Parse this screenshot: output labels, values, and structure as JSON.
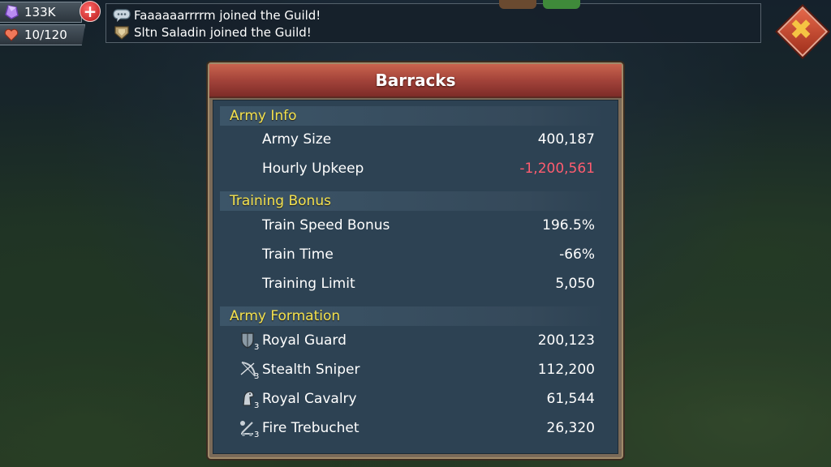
{
  "top_bar": {
    "gems": "133K",
    "stamina": "10/120",
    "plus": "+"
  },
  "feed": [
    {
      "text": "Faaaaaarrrrm joined the Guild!",
      "icon": "chat-bubble-icon"
    },
    {
      "text": "Sltn Saladin joined the Guild!",
      "icon": "guild-crest-icon"
    }
  ],
  "close": {
    "symbol": "✖"
  },
  "panel": {
    "title": "Barracks",
    "sections": [
      {
        "title": "Army Info",
        "rows": [
          {
            "label": "Army Size",
            "value": "400,187"
          },
          {
            "label": "Hourly Upkeep",
            "value": "-1,200,561"
          }
        ]
      },
      {
        "title": "Training Bonus",
        "rows": [
          {
            "label": "Train Speed Bonus",
            "value": "196.5%"
          },
          {
            "label": "Train Time",
            "value": "-66%"
          },
          {
            "label": "Training Limit",
            "value": "5,050"
          }
        ]
      },
      {
        "title": "Army Formation",
        "rows": [
          {
            "label": "Royal Guard",
            "value": "200,123",
            "icon": "shield-icon",
            "tier": "3"
          },
          {
            "label": "Stealth Sniper",
            "value": "112,200",
            "icon": "bow-icon",
            "tier": "3"
          },
          {
            "label": "Royal Cavalry",
            "value": "61,544",
            "icon": "horse-icon",
            "tier": "3"
          },
          {
            "label": "Fire Trebuchet",
            "value": "26,320",
            "icon": "trebuchet-icon",
            "tier": "3"
          }
        ]
      }
    ]
  },
  "colors": {
    "section_title": "#f4e24f",
    "negative_value": "#ff5c6f",
    "header_red": "#a3433a"
  }
}
